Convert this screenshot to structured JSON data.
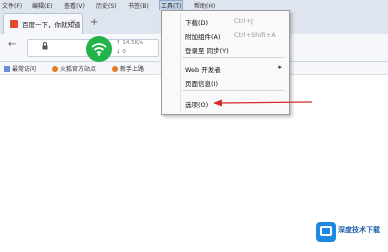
{
  "menubar": {
    "items": [
      {
        "label": "文件(F)"
      },
      {
        "label": "编辑(E)"
      },
      {
        "label": "查看(V)"
      },
      {
        "label": "历史(S)"
      },
      {
        "label": "书签(B)"
      },
      {
        "label": "工具(T)"
      },
      {
        "label": "帮助(H)"
      }
    ]
  },
  "tab": {
    "title": "百度一下，你就知道",
    "close": "×"
  },
  "newtab": {
    "label": "+"
  },
  "navbar": {
    "back": "←",
    "lock_icon": "lock-icon"
  },
  "network": {
    "up": "↑ 14.5K/s",
    "down": "↓ 0"
  },
  "bookmarks": [
    {
      "label": "最常访问",
      "color": "#6b8fd6"
    },
    {
      "label": "火狐官方站点",
      "color": "#e8791d"
    },
    {
      "label": "新手上路",
      "color": "#e8791d"
    }
  ],
  "tools_menu": {
    "items": [
      {
        "label": "下载(D)",
        "shortcut": "Ctrl+J"
      },
      {
        "label": "附加组件(A)",
        "shortcut": "Ctrl+Shift+A"
      },
      {
        "label": "登录至 同步(Y)",
        "shortcut": ""
      },
      {
        "label": "Web 开发者",
        "shortcut": "",
        "submenu": true
      },
      {
        "label": "页面信息(I)",
        "shortcut": ""
      },
      {
        "label": "选项(O)",
        "shortcut": ""
      }
    ]
  },
  "watermark": {
    "text": "深度技术下载"
  },
  "colors": {
    "chrome": "#dfe5ee",
    "wifi_green": "#24b24a",
    "arrow_red": "#d42a2a",
    "brand_blue": "#1e88e5"
  }
}
